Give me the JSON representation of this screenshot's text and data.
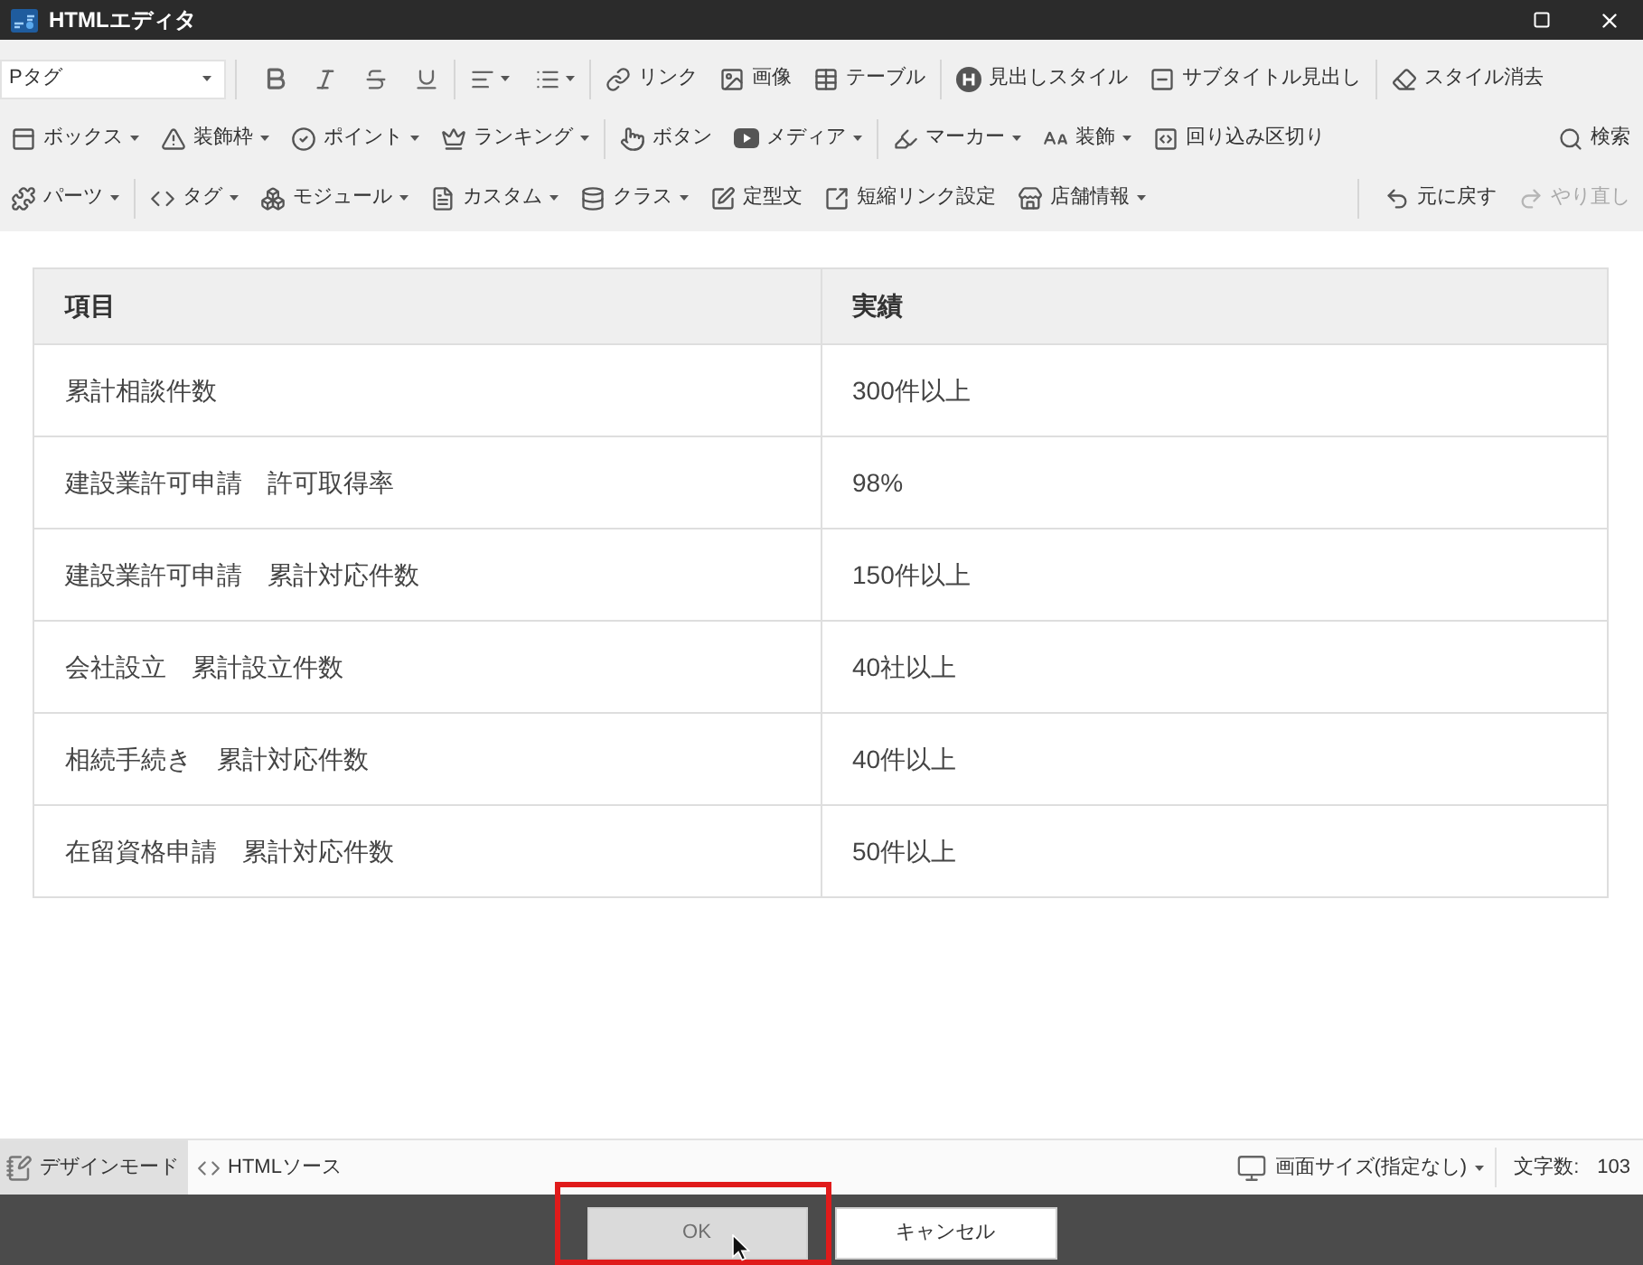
{
  "window": {
    "title": "HTMLエディタ"
  },
  "toolbar": {
    "format_select": {
      "value": "Pタグ"
    },
    "rows": [
      {
        "groups": [
          [
            {
              "label": "リンク",
              "menu": false
            },
            {
              "label": "画像",
              "menu": false
            },
            {
              "label": "テーブル",
              "menu": false
            }
          ],
          [
            {
              "label": "見出しスタイル",
              "menu": false
            },
            {
              "label": "サブタイトル見出し",
              "menu": false
            }
          ],
          [
            {
              "label": "スタイル消去",
              "menu": false
            }
          ]
        ]
      },
      {
        "groups": [
          [
            {
              "label": "ボックス",
              "menu": true
            },
            {
              "label": "装飾枠",
              "menu": true
            },
            {
              "label": "ポイント",
              "menu": true
            },
            {
              "label": "ランキング",
              "menu": true
            }
          ],
          [
            {
              "label": "ボタン",
              "menu": false
            },
            {
              "label": "メディア",
              "menu": true
            }
          ],
          [
            {
              "label": "マーカー",
              "menu": true
            },
            {
              "label": "装飾",
              "menu": true
            },
            {
              "label": "回り込み区切り",
              "menu": false
            }
          ]
        ],
        "right": [
          {
            "label": "検索",
            "disabled": false
          }
        ]
      },
      {
        "groups": [
          [
            {
              "label": "パーツ",
              "menu": true
            }
          ],
          [
            {
              "label": "タグ",
              "menu": true
            },
            {
              "label": "モジュール",
              "menu": true
            },
            {
              "label": "カスタム",
              "menu": true
            },
            {
              "label": "クラス",
              "menu": true
            },
            {
              "label": "定型文",
              "menu": false
            },
            {
              "label": "短縮リンク設定",
              "menu": false
            },
            {
              "label": "店舗情報",
              "menu": true
            }
          ]
        ],
        "right": [
          {
            "label": "元に戻す",
            "disabled": false
          },
          {
            "label": "やり直し",
            "disabled": true
          }
        ]
      }
    ]
  },
  "table": {
    "columns": [
      "項目",
      "実績"
    ],
    "rows": [
      [
        "累計相談件数",
        "300件以上"
      ],
      [
        "建設業許可申請　許可取得率",
        "98%"
      ],
      [
        "建設業許可申請　累計対応件数",
        "150件以上"
      ],
      [
        "会社設立　累計設立件数",
        "40社以上"
      ],
      [
        "相続手続き　累計対応件数",
        "40件以上"
      ],
      [
        "在留資格申請　累計対応件数",
        "50件以上"
      ]
    ]
  },
  "status_bar": {
    "modes": [
      {
        "label": "デザインモード",
        "selected": true
      },
      {
        "label": "HTMLソース",
        "selected": false
      }
    ],
    "screen_size": {
      "label": "画面サイズ(指定なし)"
    },
    "char_count": {
      "label": "文字数:",
      "value": "103"
    }
  },
  "buttons": [
    {
      "label": "OK",
      "disabled": true
    },
    {
      "label": "キャンセル",
      "disabled": false
    }
  ]
}
